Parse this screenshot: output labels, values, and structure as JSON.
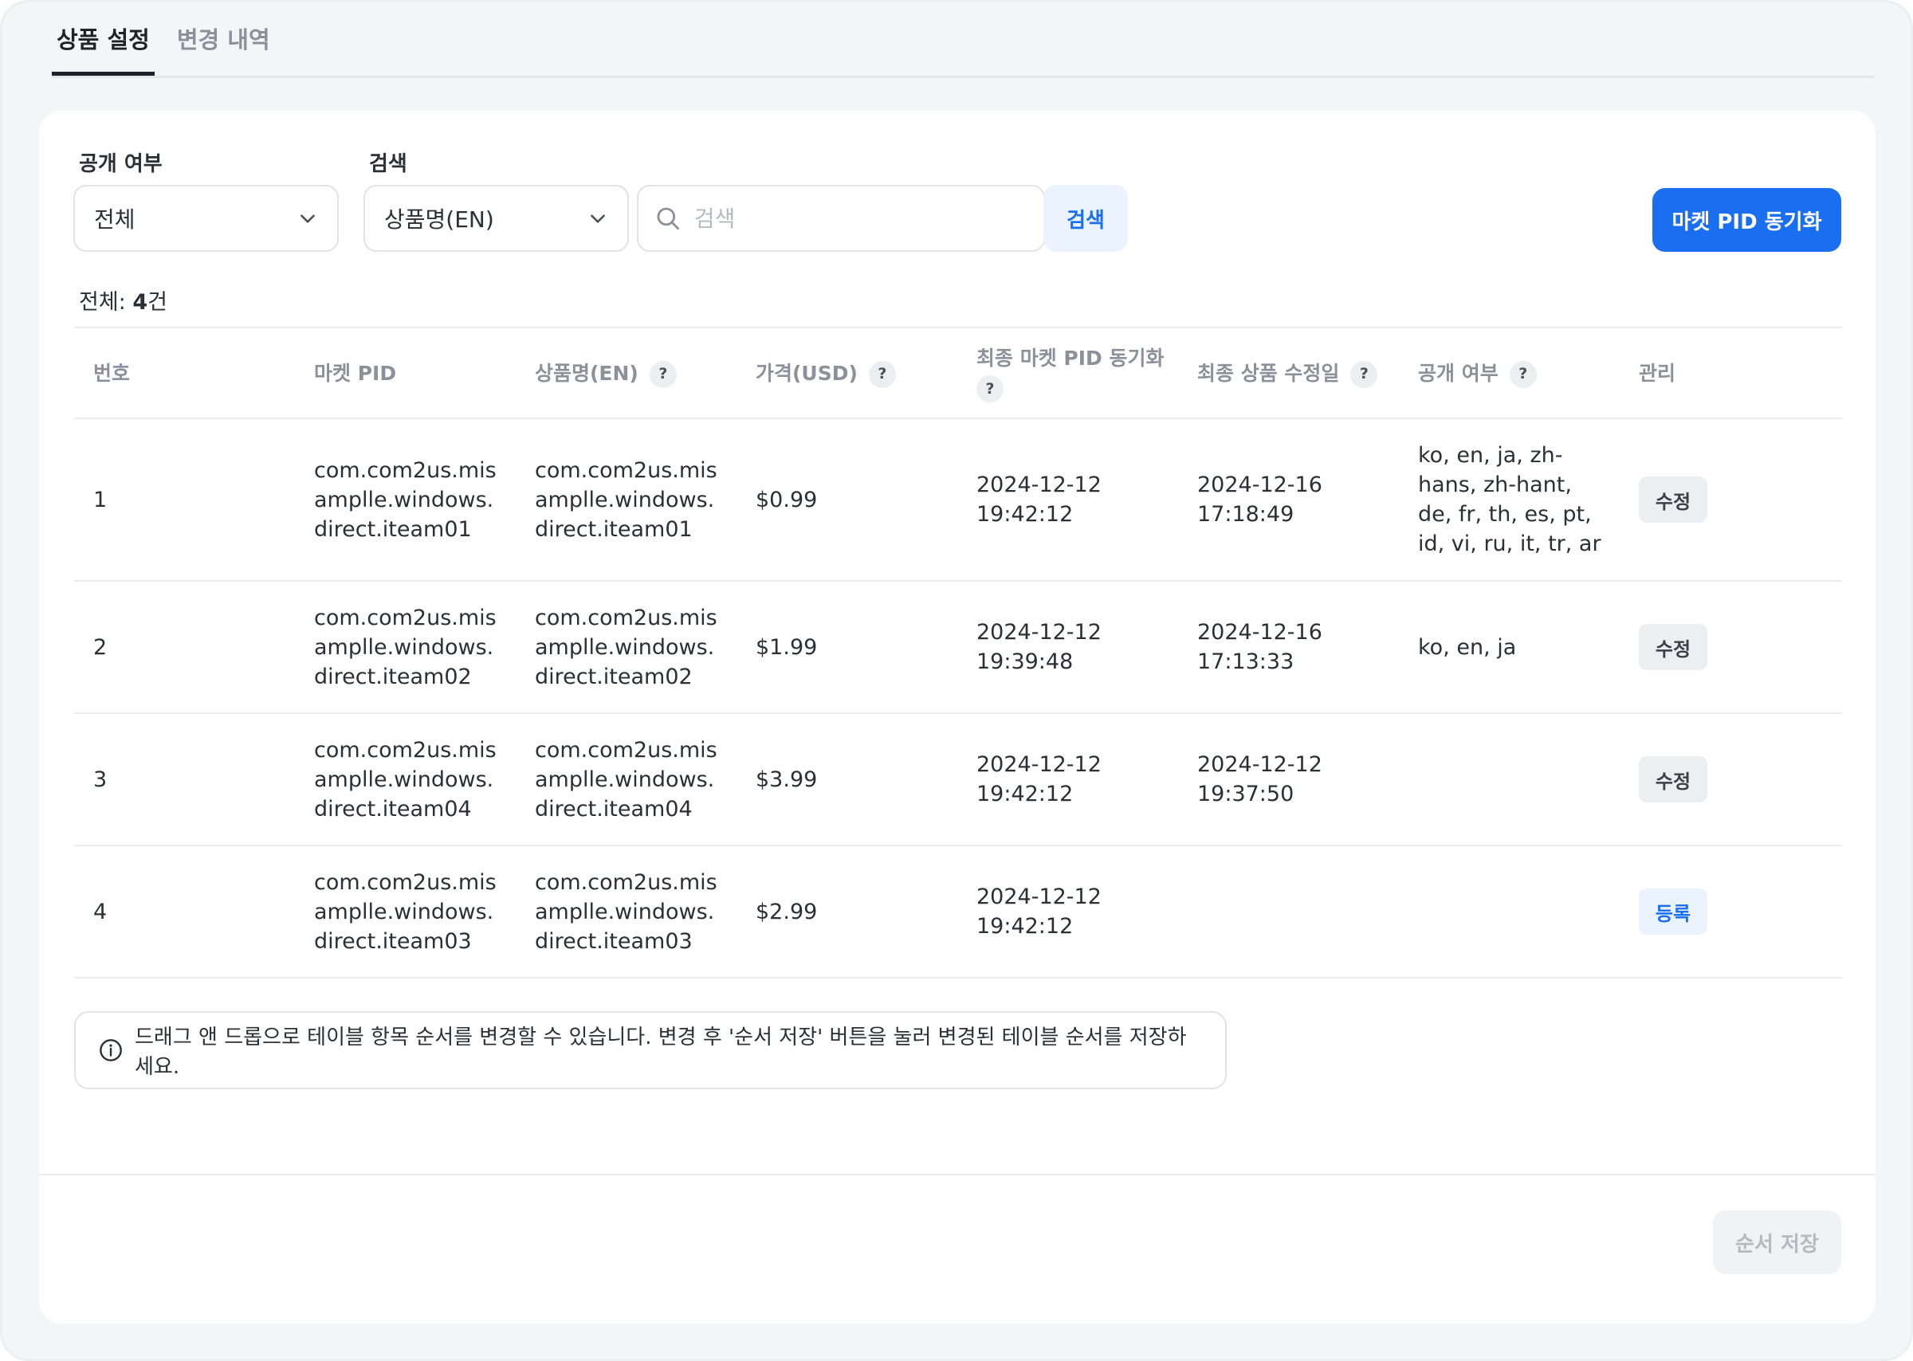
{
  "tabs": [
    {
      "label": "상품 설정",
      "active": true
    },
    {
      "label": "변경 내역",
      "active": false
    }
  ],
  "filters": {
    "visibility_label": "공개 여부",
    "visibility_value": "전체",
    "search_label": "검색",
    "search_field_value": "상품명(EN)",
    "search_placeholder": "검색",
    "search_button": "검색",
    "sync_button": "마켓 PID 동기화"
  },
  "count": {
    "prefix": "전체: ",
    "value": "4",
    "suffix": "건"
  },
  "table": {
    "headers": [
      "번호",
      "마켓 PID",
      "상품명(EN)",
      "가격(USD)",
      "최종 마켓 PID 동기화",
      "최종 상품 수정일",
      "공개 여부",
      "관리"
    ],
    "rows": [
      {
        "no": "1",
        "pid": "com.com2us.misamplle.windows.direct.iteam01",
        "name": "com.com2us.misamplle.windows.direct.iteam01",
        "price": "$0.99",
        "sync": "2024-12-12 19:42:12",
        "modified": "2024-12-16 17:18:49",
        "visibility": "ko, en, ja, zh-hans, zh-hant, de, fr, th, es, pt, id, vi, ru, it, tr, ar",
        "action": "수정"
      },
      {
        "no": "2",
        "pid": "com.com2us.misamplle.windows.direct.iteam02",
        "name": "com.com2us.misamplle.windows.direct.iteam02",
        "price": "$1.99",
        "sync": "2024-12-12 19:39:48",
        "modified": "2024-12-16 17:13:33",
        "visibility": "ko, en, ja",
        "action": "수정"
      },
      {
        "no": "3",
        "pid": "com.com2us.misamplle.windows.direct.iteam04",
        "name": "com.com2us.misamplle.windows.direct.iteam04",
        "price": "$3.99",
        "sync": "2024-12-12 19:42:12",
        "modified": "2024-12-12 19:37:50",
        "visibility": "",
        "action": "수정"
      },
      {
        "no": "4",
        "pid": "com.com2us.misamplle.windows.direct.iteam03",
        "name": "com.com2us.misamplle.windows.direct.iteam03",
        "price": "$2.99",
        "sync": "2024-12-12 19:42:12",
        "modified": "",
        "visibility": "",
        "action": "등록"
      }
    ]
  },
  "help_icon": "?",
  "notice": "드래그 앤 드롭으로 테이블 항목 순서를 변경할 수 있습니다. 변경 후 '순서 저장' 버튼을 눌러 변경된 테이블 순서를 저장하세요.",
  "save_button": "순서 저장",
  "colors": {
    "primary": "#1a6ff0",
    "primary_light": "#eaf3ff",
    "muted": "#8b9099"
  }
}
